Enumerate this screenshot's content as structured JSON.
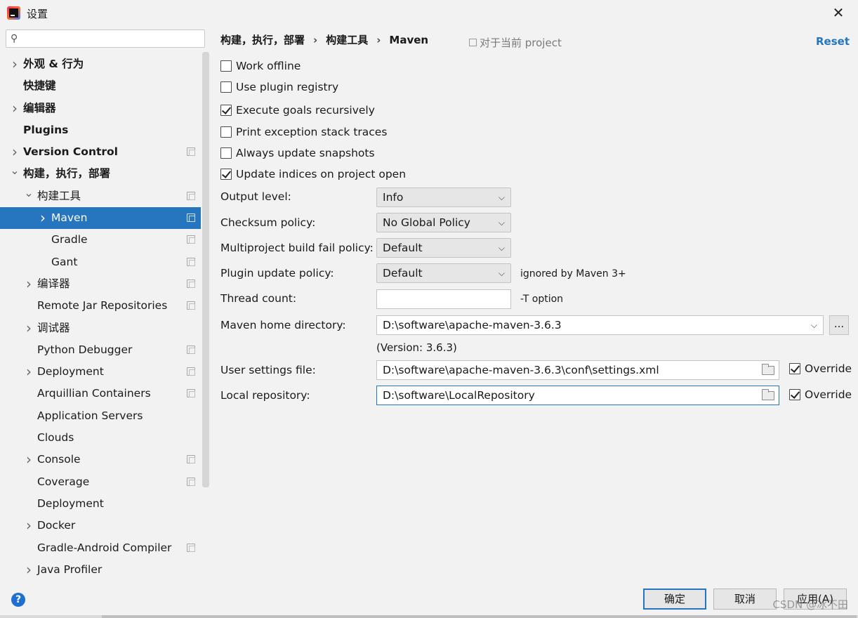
{
  "window": {
    "title": "设置",
    "close_glyph": "✕"
  },
  "sidebar": {
    "search": {
      "value": "",
      "placeholder": ""
    },
    "items": [
      {
        "label": "外观 & 行为",
        "expandable": true,
        "indent": 0,
        "bold": true,
        "project_icon": false
      },
      {
        "label": "快捷键",
        "expandable": false,
        "indent": 0,
        "bold": true,
        "project_icon": false
      },
      {
        "label": "编辑器",
        "expandable": true,
        "indent": 0,
        "bold": true,
        "project_icon": false
      },
      {
        "label": "Plugins",
        "expandable": false,
        "indent": 0,
        "bold": true,
        "project_icon": false
      },
      {
        "label": "Version Control",
        "expandable": true,
        "indent": 0,
        "bold": true,
        "project_icon": true
      },
      {
        "label": "构建，执行，部署",
        "expandable": true,
        "expanded": true,
        "indent": 0,
        "bold": true,
        "project_icon": false
      },
      {
        "label": "构建工具",
        "expandable": true,
        "expanded": true,
        "indent": 1,
        "bold": false,
        "project_icon": true
      },
      {
        "label": "Maven",
        "expandable": true,
        "indent": 2,
        "bold": false,
        "project_icon": true,
        "selected": true
      },
      {
        "label": "Gradle",
        "expandable": false,
        "indent": 2,
        "bold": false,
        "project_icon": true
      },
      {
        "label": "Gant",
        "expandable": false,
        "indent": 2,
        "bold": false,
        "project_icon": true
      },
      {
        "label": "编译器",
        "expandable": true,
        "indent": 1,
        "bold": false,
        "project_icon": true
      },
      {
        "label": "Remote Jar Repositories",
        "expandable": false,
        "indent": 1,
        "bold": false,
        "project_icon": true
      },
      {
        "label": "调试器",
        "expandable": true,
        "indent": 1,
        "bold": false,
        "project_icon": false
      },
      {
        "label": "Python Debugger",
        "expandable": false,
        "indent": 1,
        "bold": false,
        "project_icon": true
      },
      {
        "label": "Deployment",
        "expandable": true,
        "indent": 1,
        "bold": false,
        "project_icon": true
      },
      {
        "label": "Arquillian Containers",
        "expandable": false,
        "indent": 1,
        "bold": false,
        "project_icon": true
      },
      {
        "label": "Application Servers",
        "expandable": false,
        "indent": 1,
        "bold": false,
        "project_icon": false
      },
      {
        "label": "Clouds",
        "expandable": false,
        "indent": 1,
        "bold": false,
        "project_icon": false
      },
      {
        "label": "Console",
        "expandable": true,
        "indent": 1,
        "bold": false,
        "project_icon": true
      },
      {
        "label": "Coverage",
        "expandable": false,
        "indent": 1,
        "bold": false,
        "project_icon": true
      },
      {
        "label": "Deployment",
        "expandable": false,
        "indent": 1,
        "bold": false,
        "project_icon": false
      },
      {
        "label": "Docker",
        "expandable": true,
        "indent": 1,
        "bold": false,
        "project_icon": false
      },
      {
        "label": "Gradle-Android Compiler",
        "expandable": false,
        "indent": 1,
        "bold": false,
        "project_icon": true
      },
      {
        "label": "Java Profiler",
        "expandable": true,
        "indent": 1,
        "bold": false,
        "project_icon": false
      }
    ]
  },
  "header": {
    "breadcrumb": [
      "构建，执行，部署",
      "构建工具",
      "Maven"
    ],
    "breadcrumb_separator": "›",
    "scope_label": "对于当前 project",
    "reset_label": "Reset"
  },
  "options": [
    {
      "label": "Work offline",
      "checked": false
    },
    {
      "label": "Use plugin registry",
      "checked": false
    },
    {
      "label": "Execute goals recursively",
      "checked": true
    },
    {
      "label": "Print exception stack traces",
      "checked": false
    },
    {
      "label": "Always update snapshots",
      "checked": false
    },
    {
      "label": "Update indices on project open",
      "checked": true
    }
  ],
  "fields": {
    "output_level": {
      "label": "Output level:",
      "value": "Info"
    },
    "checksum_policy": {
      "label": "Checksum policy:",
      "value": "No Global Policy"
    },
    "multiproject_policy": {
      "label": "Multiproject build fail policy:",
      "value": "Default"
    },
    "plugin_update_policy": {
      "label": "Plugin update policy:",
      "value": "Default",
      "hint": "ignored by Maven 3+"
    },
    "thread_count": {
      "label": "Thread count:",
      "value": "",
      "hint": "-T option"
    },
    "maven_home": {
      "label": "Maven home directory:",
      "value": "D:\\software\\apache-maven-3.6.3",
      "version": "(Version: 3.6.3)",
      "browse_label": "..."
    },
    "user_settings": {
      "label": "User settings file:",
      "value": "D:\\software\\apache-maven-3.6.3\\conf\\settings.xml",
      "override_label": "Override",
      "override": true
    },
    "local_repository": {
      "label": "Local repository:",
      "value": "D:\\software\\LocalRepository",
      "override_label": "Override",
      "override": true
    }
  },
  "footer": {
    "help_glyph": "?",
    "ok_label": "确定",
    "cancel_label": "取消",
    "apply_label": "应用(A)",
    "watermark": "CSDN @冰不田"
  },
  "colors": {
    "accent": "#2675bf",
    "background": "#f2f2f2"
  }
}
